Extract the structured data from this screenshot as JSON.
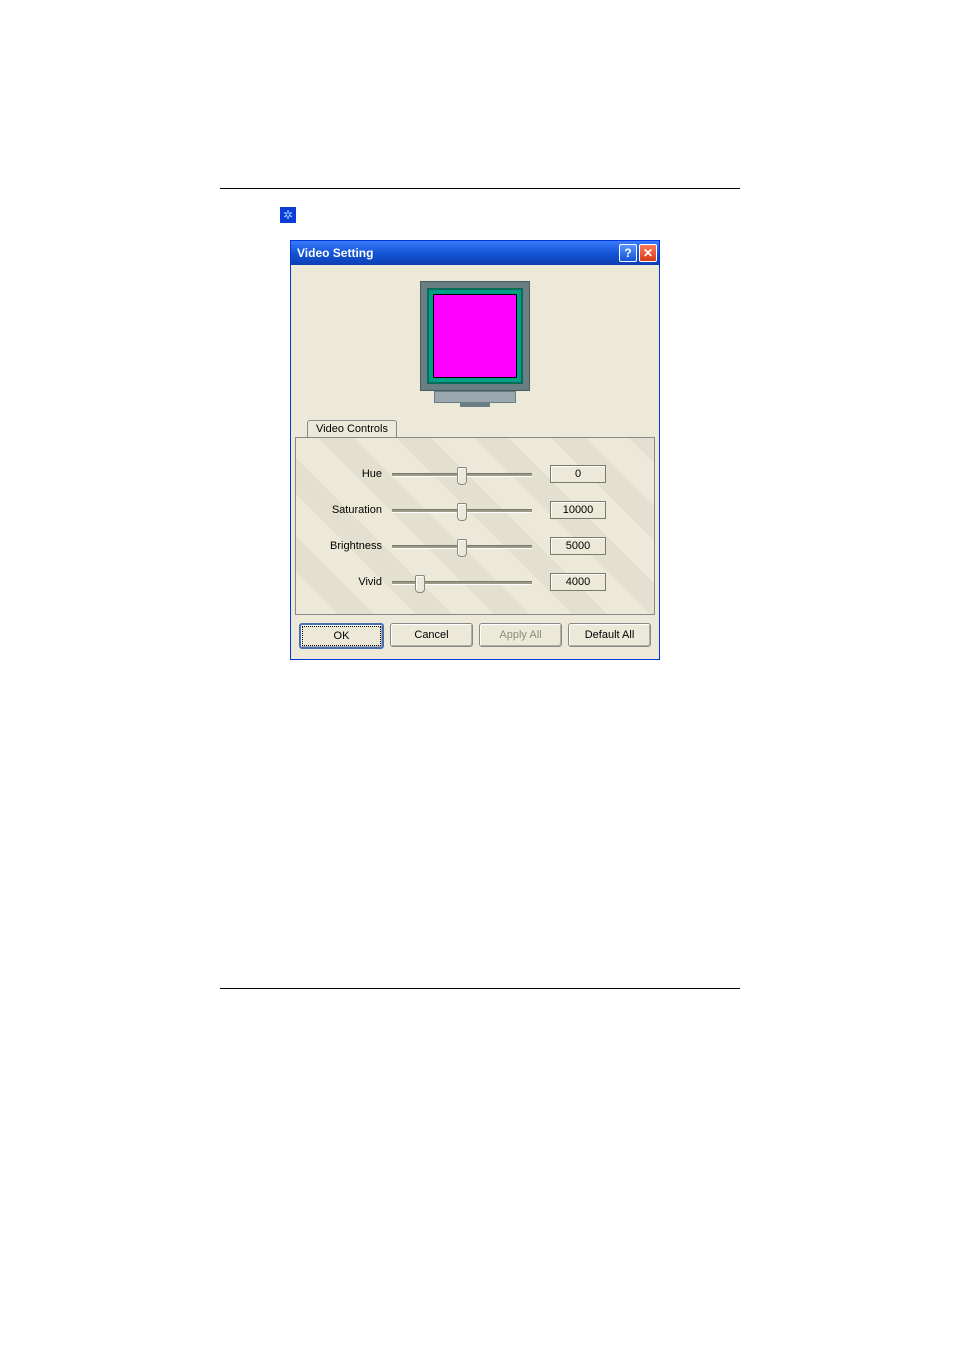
{
  "dialog": {
    "title": "Video Setting",
    "help_symbol": "?",
    "close_symbol": "✕",
    "tab_label": "Video Controls"
  },
  "controls": [
    {
      "label": "Hue",
      "value": "0",
      "pos_pct": 50
    },
    {
      "label": "Saturation",
      "value": "10000",
      "pos_pct": 50
    },
    {
      "label": "Brightness",
      "value": "5000",
      "pos_pct": 50
    },
    {
      "label": "Vivid",
      "value": "4000",
      "pos_pct": 20
    }
  ],
  "buttons": {
    "ok": "OK",
    "cancel": "Cancel",
    "apply_all": "Apply All",
    "default_all": "Default All"
  }
}
